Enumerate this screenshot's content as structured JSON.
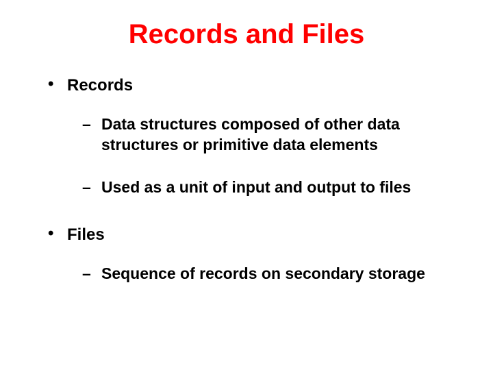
{
  "title": "Records and Files",
  "bullets": {
    "records": {
      "label": "Records",
      "sub1": "Data structures composed of other data structures or primitive data elements",
      "sub2": "Used as a unit of input and output to files"
    },
    "files": {
      "label": "Files",
      "sub1": "Sequence of records on secondary storage"
    }
  }
}
